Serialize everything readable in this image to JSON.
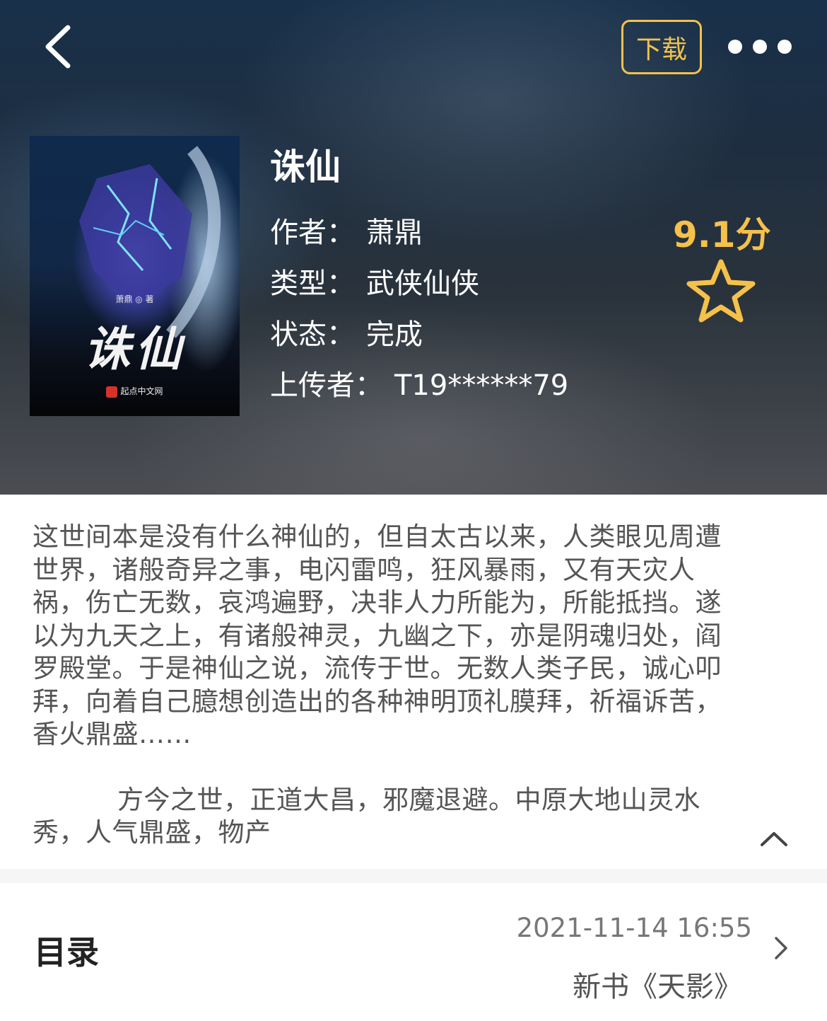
{
  "header": {
    "download_label": "下载"
  },
  "book": {
    "title": "诛仙",
    "author_label": "作者：",
    "author": "萧鼎",
    "genre_label": "类型：",
    "genre": "武侠仙侠",
    "status_label": "状态：",
    "status": "完成",
    "uploader_label": "上传者：",
    "uploader": "T19******79",
    "score": "9.1分"
  },
  "cover": {
    "author_text": "萧鼎 ◎ 著",
    "title_text": "诛仙",
    "publisher_text": "起点中文网"
  },
  "synopsis": {
    "paragraph1": "这世间本是没有什么神仙的，但自太古以来，人类眼见周遭世界，诸般奇异之事，电闪雷鸣，狂风暴雨，又有天灾人祸，伤亡无数，哀鸿遍野，决非人力所能为，所能抵挡。遂以为九天之上，有诸般神灵，九幽之下，亦是阴魂归处，阎罗殿堂。于是神仙之说，流传于世。无数人类子民，诚心叩拜，向着自己臆想创造出的各种神明顶礼膜拜，祈福诉苦，香火鼎盛……",
    "paragraph2": "方今之世，正道大昌，邪魔退避。中原大地山灵水秀，人气鼎盛，物产"
  },
  "catalog": {
    "label": "目录",
    "updated": "2021-11-14 16:55",
    "latest_chapter": "新书《天影》"
  },
  "colors": {
    "accent": "#f5c14a",
    "text_body": "#555555"
  },
  "icons": [
    "back-arrow-icon",
    "more-dots-icon",
    "star-outline-icon",
    "chevron-up-icon",
    "chevron-right-icon"
  ]
}
